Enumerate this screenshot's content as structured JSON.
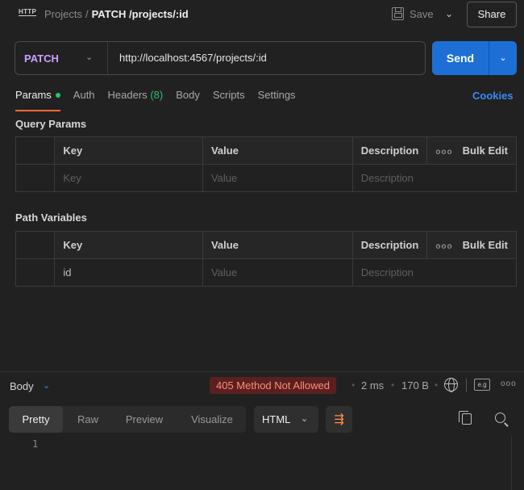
{
  "header": {
    "http_icon": "HTTP",
    "breadcrumb_parent": "Projects",
    "breadcrumb_sep": "/",
    "request_name": "PATCH /projects/:id",
    "save_label": "Save",
    "save_chevron": "⌄",
    "share_label": "Share"
  },
  "request": {
    "method": "PATCH",
    "method_chevron": "⌄",
    "url": "http://localhost:4567/projects/:id",
    "send_label": "Send",
    "send_chevron": "⌄"
  },
  "tabs": [
    {
      "label": "Params",
      "active": true,
      "dot": true
    },
    {
      "label": "Auth"
    },
    {
      "label": "Headers",
      "count": "(8)"
    },
    {
      "label": "Body"
    },
    {
      "label": "Scripts"
    },
    {
      "label": "Settings"
    }
  ],
  "cookies_label": "Cookies",
  "query_params": {
    "title": "Query Params",
    "columns": [
      "Key",
      "Value",
      "Description"
    ],
    "bulk_edit": "Bulk Edit",
    "more": "ooo",
    "rows": [
      {
        "key": "Key",
        "value": "Value",
        "description": "Description",
        "placeholder": true
      }
    ]
  },
  "path_variables": {
    "title": "Path Variables",
    "columns": [
      "Key",
      "Value",
      "Description"
    ],
    "bulk_edit": "Bulk Edit",
    "more": "ooo",
    "rows": [
      {
        "key": "id",
        "value": "Value",
        "description": "Description"
      }
    ]
  },
  "response": {
    "body_label": "Body",
    "body_chevron": "⌄",
    "status": "405 Method Not Allowed",
    "time": "2 ms",
    "size": "170 B",
    "sep": "•",
    "eg_label": "e.g",
    "more": "ooo",
    "tabs": [
      "Pretty",
      "Raw",
      "Preview",
      "Visualize"
    ],
    "active_tab": "Pretty",
    "format": "HTML",
    "format_chevron": "⌄",
    "wrap_icon": "⇶",
    "line_numbers": [
      "1"
    ]
  },
  "colors": {
    "accent_send": "#1d6fd6",
    "method": "#c9a0ff",
    "status_bg": "#5a2020",
    "status_text": "#ff8b7a",
    "tab_underline": "#ff6c37",
    "green": "#2fbf71",
    "link": "#3b8af5"
  }
}
